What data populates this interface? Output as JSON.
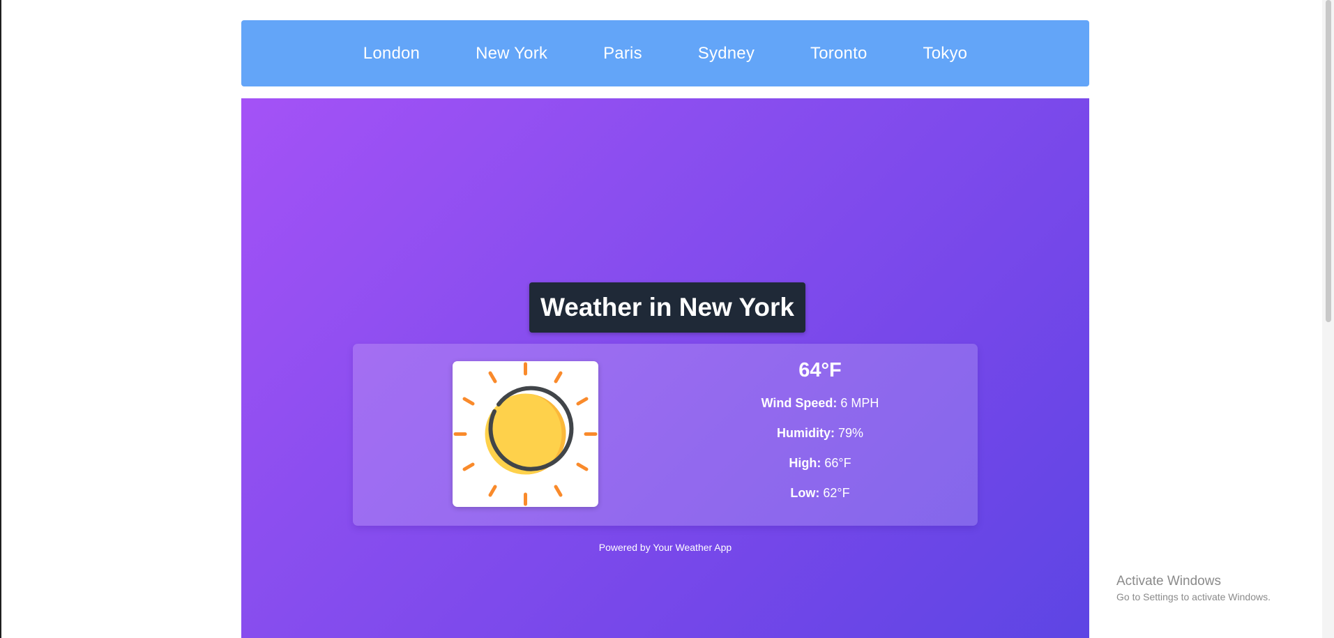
{
  "nav": {
    "links": [
      "London",
      "New York",
      "Paris",
      "Sydney",
      "Toronto",
      "Tokyo"
    ]
  },
  "weather": {
    "title": "Weather in New York",
    "icon": "sun-icon",
    "temperature": "64°F",
    "wind_label": "Wind Speed:",
    "wind_value": "6 MPH",
    "humidity_label": "Humidity:",
    "humidity_value": "79%",
    "high_label": "High:",
    "high_value": "66°F",
    "low_label": "Low:",
    "low_value": "62°F"
  },
  "footer": {
    "text": "Powered by Your Weather App"
  },
  "os_watermark": {
    "title": "Activate Windows",
    "subtitle": "Go to Settings to activate Windows."
  },
  "colors": {
    "navbar": "#63a5f8",
    "title_bg": "#1f2937",
    "gradient_start": "#a452f6",
    "gradient_end": "#5d45e4",
    "sun_fill": "#fed14b",
    "sun_rays": "#f98a2b"
  }
}
